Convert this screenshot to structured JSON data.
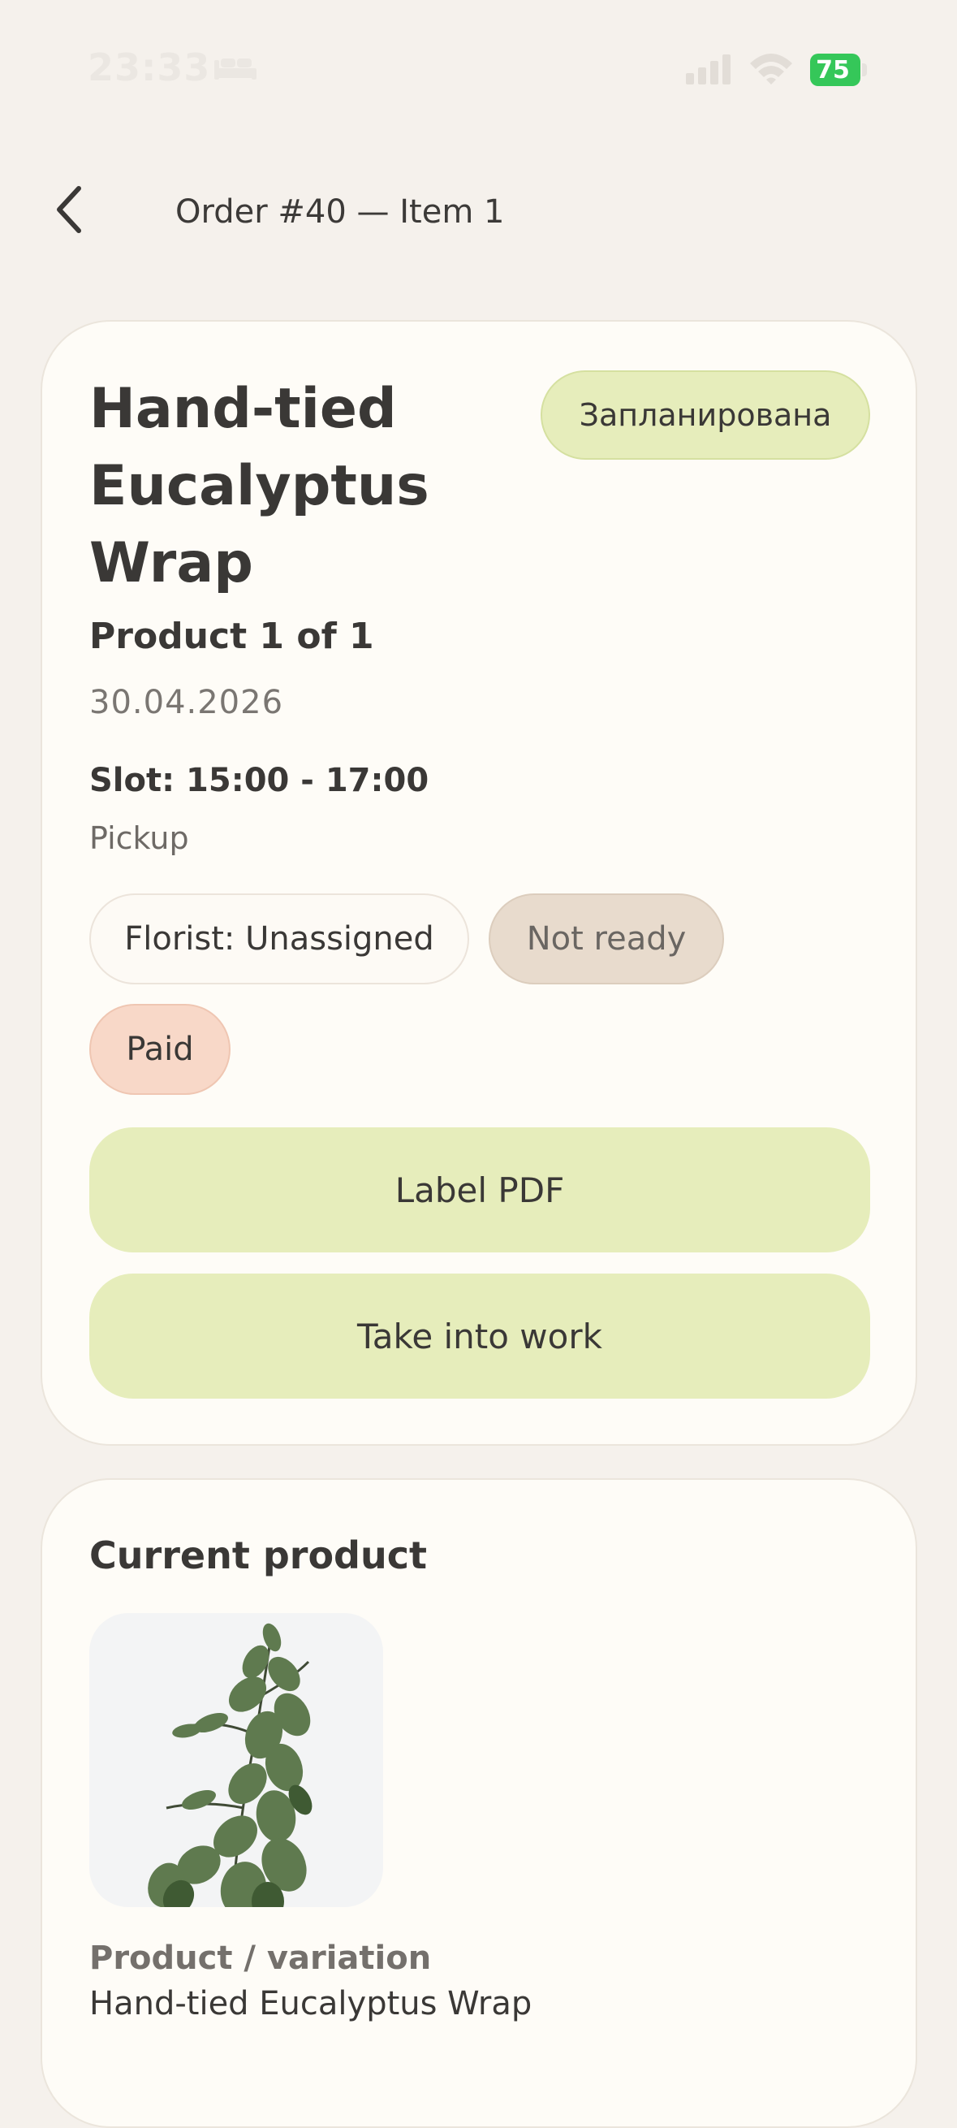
{
  "status_bar": {
    "time": "23:33",
    "battery": "75",
    "icons": [
      "bed-icon",
      "signal-icon",
      "wifi-icon",
      "battery-icon"
    ]
  },
  "header": {
    "back_icon": "chevron-left-icon",
    "title": "Order #40 — Item 1"
  },
  "order_card": {
    "product_title": "Hand-tied Eucalyptus Wrap",
    "status": "Запланирована",
    "product_count": "Product 1 of 1",
    "date": "30.04.2026",
    "slot": "Slot: 15:00 - 17:00",
    "delivery_type": "Pickup",
    "tags": {
      "florist": "Florist: Unassigned",
      "readiness": "Not ready",
      "payment": "Paid"
    },
    "buttons": {
      "label_pdf": "Label PDF",
      "take_into_work": "Take into work"
    }
  },
  "product_card": {
    "section_title": "Current product",
    "image_subject": "eucalyptus-branch",
    "variation_label": "Product / variation",
    "variation_value": "Hand-tied Eucalyptus Wrap"
  },
  "colors": {
    "background": "#f5f1ec",
    "card": "#fefcf7",
    "accent_green": "#e6edbb",
    "not_ready": "#e8dbcd",
    "paid": "#f8d8c8",
    "battery_green": "#35c759"
  }
}
